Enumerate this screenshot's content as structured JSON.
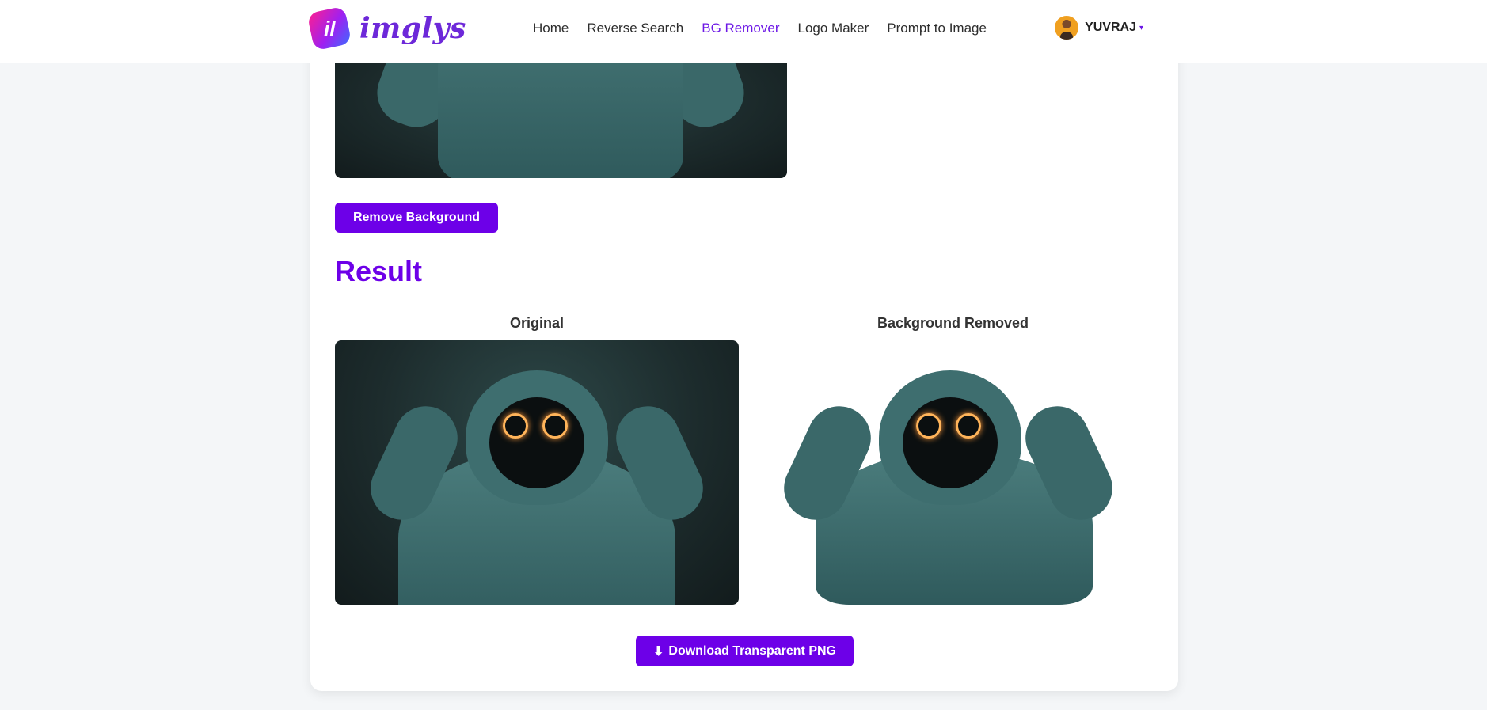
{
  "header": {
    "logo_mark": "il",
    "logo_text": "imglys",
    "nav": [
      {
        "label": "Home"
      },
      {
        "label": "Reverse Search"
      },
      {
        "label": "BG Remover"
      },
      {
        "label": "Logo Maker"
      },
      {
        "label": "Prompt to Image"
      }
    ],
    "active_nav": "BG Remover",
    "user": {
      "name": "YUVRAJ"
    }
  },
  "main": {
    "remove_button_label": "Remove Background",
    "result_title": "Result",
    "original_caption": "Original",
    "removed_caption": "Background Removed",
    "download_label": "Download Transparent PNG"
  },
  "colors": {
    "accent": "#6d00e8",
    "background": "#f4f6f8"
  },
  "icons": {
    "download": "download-icon",
    "caret": "caret-down-icon"
  }
}
